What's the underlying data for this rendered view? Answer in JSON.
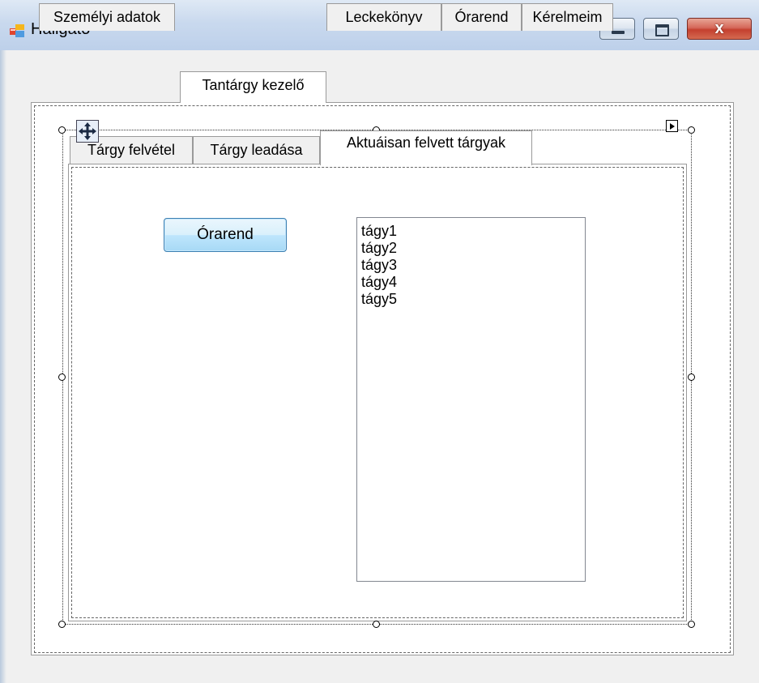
{
  "window": {
    "title": "Hallgató",
    "close_glyph": "x",
    "icon": "app-window-icon"
  },
  "main_tabs": [
    {
      "label": "Személyi adatok",
      "active": false
    },
    {
      "label": "Tantárgy kezelő",
      "active": true
    },
    {
      "label": "Leckekönyv",
      "active": false
    },
    {
      "label": "Órarend",
      "active": false
    },
    {
      "label": "Kérelmeim",
      "active": false
    }
  ],
  "sub_tabs": [
    {
      "label": "Tárgy felvétel",
      "active": false
    },
    {
      "label": "Tárgy leadása",
      "active": false
    },
    {
      "label": "Aktuáisan felvett tárgyak",
      "active": true
    }
  ],
  "content": {
    "timetable_button_label": "Órarend",
    "subjects_list": [
      "tágy1",
      "tágy2",
      "tágy3",
      "tágy4",
      "tágy5"
    ]
  },
  "colors": {
    "accent_button_border": "#3c7fb1",
    "close_button": "#c4402f"
  }
}
